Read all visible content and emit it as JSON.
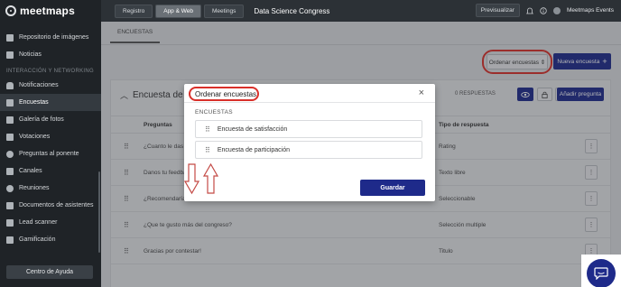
{
  "app": {
    "logo_text": "meetmaps"
  },
  "sidebar": {
    "items_top": [
      {
        "label": "Repositorio de imágenes",
        "icon": "folder-icon"
      },
      {
        "label": "Noticias",
        "icon": "news-icon"
      }
    ],
    "section_label": "INTERACCIÓN Y NETWORKING",
    "items": [
      {
        "label": "Notificaciones",
        "icon": "bell-icon"
      },
      {
        "label": "Encuestas",
        "icon": "list-icon",
        "active": true
      },
      {
        "label": "Galería de fotos",
        "icon": "image-icon"
      },
      {
        "label": "Votaciones",
        "icon": "vote-icon"
      },
      {
        "label": "Preguntas al ponente",
        "icon": "chat-icon"
      },
      {
        "label": "Canales",
        "icon": "channel-icon"
      },
      {
        "label": "Reuniones",
        "icon": "meeting-icon"
      },
      {
        "label": "Documentos de asistentes",
        "icon": "document-icon"
      },
      {
        "label": "Lead scanner",
        "icon": "scanner-icon"
      },
      {
        "label": "Gamificación",
        "icon": "trophy-icon"
      }
    ],
    "help_label": "Centro de Ayuda"
  },
  "topbar": {
    "tabs": [
      {
        "label": "Registro"
      },
      {
        "label": "App & Web",
        "active": true
      },
      {
        "label": "Meetings"
      }
    ],
    "event_title": "Data Science Congress",
    "preview_label": "Previsualizar",
    "user_name": "Meetmaps Events"
  },
  "page": {
    "tab_label": "ENCUESTAS",
    "order_button": "Ordenar encuestas ⇕",
    "new_button": "Nueva encuesta",
    "new_button_icon": "+",
    "survey_title": "Encuesta de s",
    "responses": "0 RESPUESTAS",
    "add_question": "Añadir pregunta",
    "col_questions": "Preguntas",
    "col_type": "Tipo de respuesta",
    "questions": [
      {
        "text": "¿Cuanto le das al",
        "type": "Rating"
      },
      {
        "text": "Danos tu feedback",
        "type": "Texto libre"
      },
      {
        "text": "¿Recomendarías el",
        "type": "Seleccionable"
      },
      {
        "text": "¿Que te gusto más del congreso?",
        "type": "Selección multiple"
      },
      {
        "text": "Gracias por contestar!",
        "type": "Titulo"
      }
    ]
  },
  "modal": {
    "title": "Ordenar encuestas",
    "close": "×",
    "section": "ENCUESTAS",
    "items": [
      {
        "label": "Encuesta de satisfacción"
      },
      {
        "label": "Encuesta de participación"
      }
    ],
    "save_label": "Guardar"
  },
  "colors": {
    "primary": "#1e2a8a",
    "highlight": "#d9302a",
    "sidebar_bg": "#1f2327"
  }
}
